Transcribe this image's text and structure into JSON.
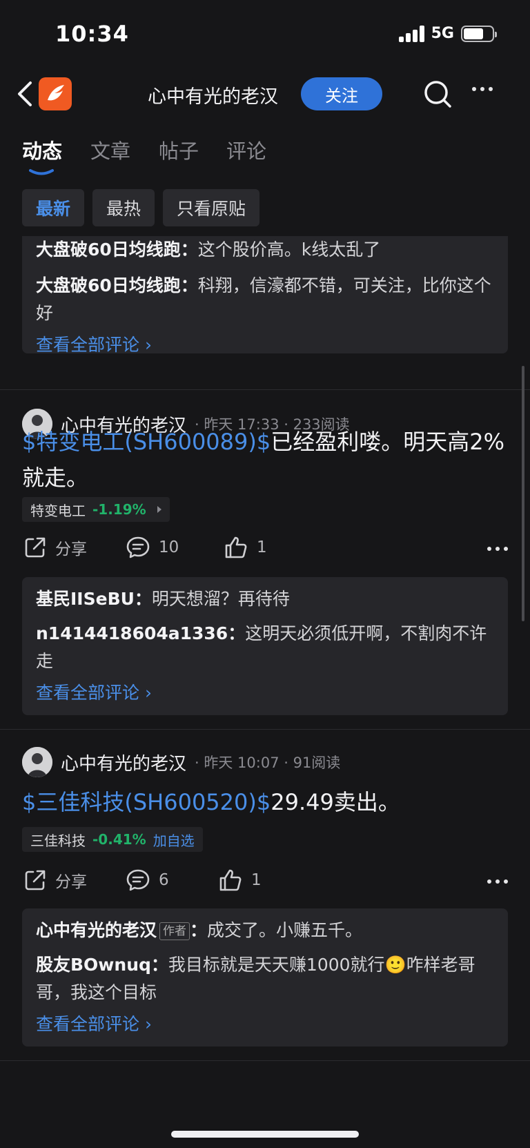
{
  "status": {
    "time": "10:34",
    "network": "5G",
    "battery_level": 0.7
  },
  "nav": {
    "title": "心中有光的老汉",
    "follow_label": "关注"
  },
  "tabs": [
    {
      "label": "动态",
      "active": true
    },
    {
      "label": "文章",
      "active": false
    },
    {
      "label": "帖子",
      "active": false
    },
    {
      "label": "评论",
      "active": false
    }
  ],
  "filters": [
    {
      "label": "最新",
      "active": true
    },
    {
      "label": "最热",
      "active": false
    },
    {
      "label": "只看原贴",
      "active": false
    }
  ],
  "top_comments": {
    "items": [
      {
        "user": "大盘破60日均线跑：",
        "text": "这个股价高。k线太乱了"
      },
      {
        "user": "大盘破60日均线跑：",
        "text": "科翔，信濠都不错，可关注，比你这个好"
      }
    ],
    "view_all": "查看全部评论 ›"
  },
  "posts": [
    {
      "author": "心中有光的老汉",
      "meta": "· 昨天 17:33 · 233阅读",
      "stock_link": "$特变电工(SH600089)$",
      "text": "已经盈利喽。明天高2%就走。",
      "tag": {
        "name": "特变电工",
        "change": "-1.19%"
      },
      "actions": {
        "share": "分享",
        "comments": "10",
        "likes": "1"
      },
      "comments": [
        {
          "user": "基民IISeBU：",
          "text": "明天想溜？再待待"
        },
        {
          "user": "n1414418604a1336：",
          "text": "这明天必须低开啊，不割肉不许走"
        }
      ],
      "view_all": "查看全部评论 ›"
    },
    {
      "author": "心中有光的老汉",
      "meta": "· 昨天 10:07 · 91阅读",
      "stock_link": "$三佳科技(SH600520)$",
      "text": "29.49卖出。",
      "tag": {
        "name": "三佳科技",
        "change": "-0.41%",
        "add": "加自选"
      },
      "actions": {
        "share": "分享",
        "comments": "6",
        "likes": "1"
      },
      "comments": [
        {
          "user": "心中有光的老汉",
          "author_tag": "作者",
          "user_suffix": "：",
          "text": "成交了。小赚五千。"
        },
        {
          "user": "股友BOwnuq：",
          "text": "我目标就是天天赚1000就行",
          "emoji": "🙂",
          "text_after": "咋样老哥哥，我这个目标"
        }
      ],
      "view_all": "查看全部评论 ›"
    }
  ]
}
